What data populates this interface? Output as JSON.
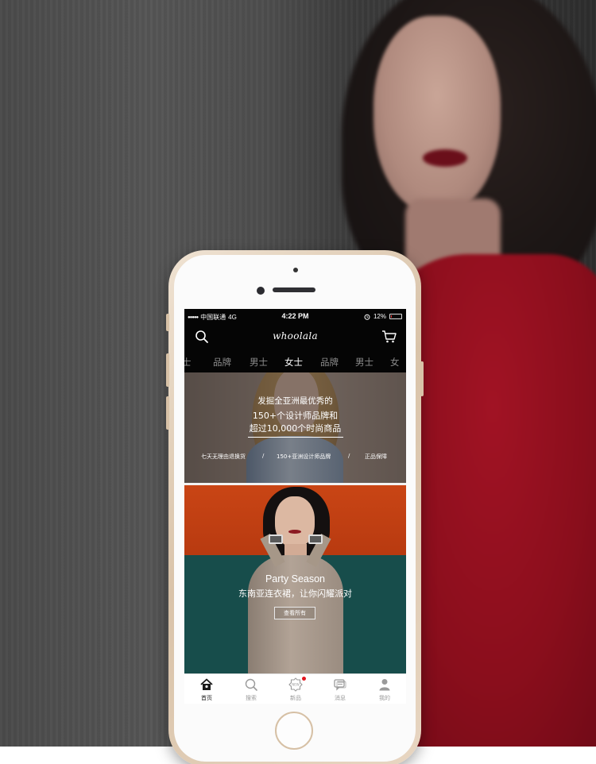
{
  "status_bar": {
    "signal": "●●●●●",
    "carrier": "中国联通",
    "network": "4G",
    "time": "4:22 PM",
    "battery_percent": "12%",
    "battery_level": 0.12
  },
  "header": {
    "logo": "whoolala"
  },
  "category_tabs": [
    {
      "label": "士"
    },
    {
      "label": "品牌"
    },
    {
      "label": "男士"
    },
    {
      "label": "女士",
      "active": true
    },
    {
      "label": "品牌"
    },
    {
      "label": "男士"
    },
    {
      "label": "女"
    }
  ],
  "banner_brand": {
    "line1": "发掘全亚洲最优秀的",
    "line2": "150+个设计师品牌和",
    "line3": "超过10,000个时尚商品",
    "features": [
      "七天无理由退换货",
      "/",
      "150+亚洲设计师品牌",
      "/",
      "正品保障"
    ]
  },
  "banner_party": {
    "title": "Party Season",
    "subtitle": "东南亚连衣裙，让你闪耀派对",
    "button": "查看所有"
  },
  "bottom_nav": [
    {
      "label": "首页",
      "icon": "home-icon",
      "active": true
    },
    {
      "label": "搜索",
      "icon": "search-icon"
    },
    {
      "label": "新品",
      "icon": "new-icon",
      "badge": true
    },
    {
      "label": "消息",
      "icon": "message-icon"
    },
    {
      "label": "我的",
      "icon": "profile-icon"
    }
  ],
  "colors": {
    "header_bg": "#050505",
    "badge_red": "#e3151e",
    "phone_gold": "#d9c3a9"
  }
}
